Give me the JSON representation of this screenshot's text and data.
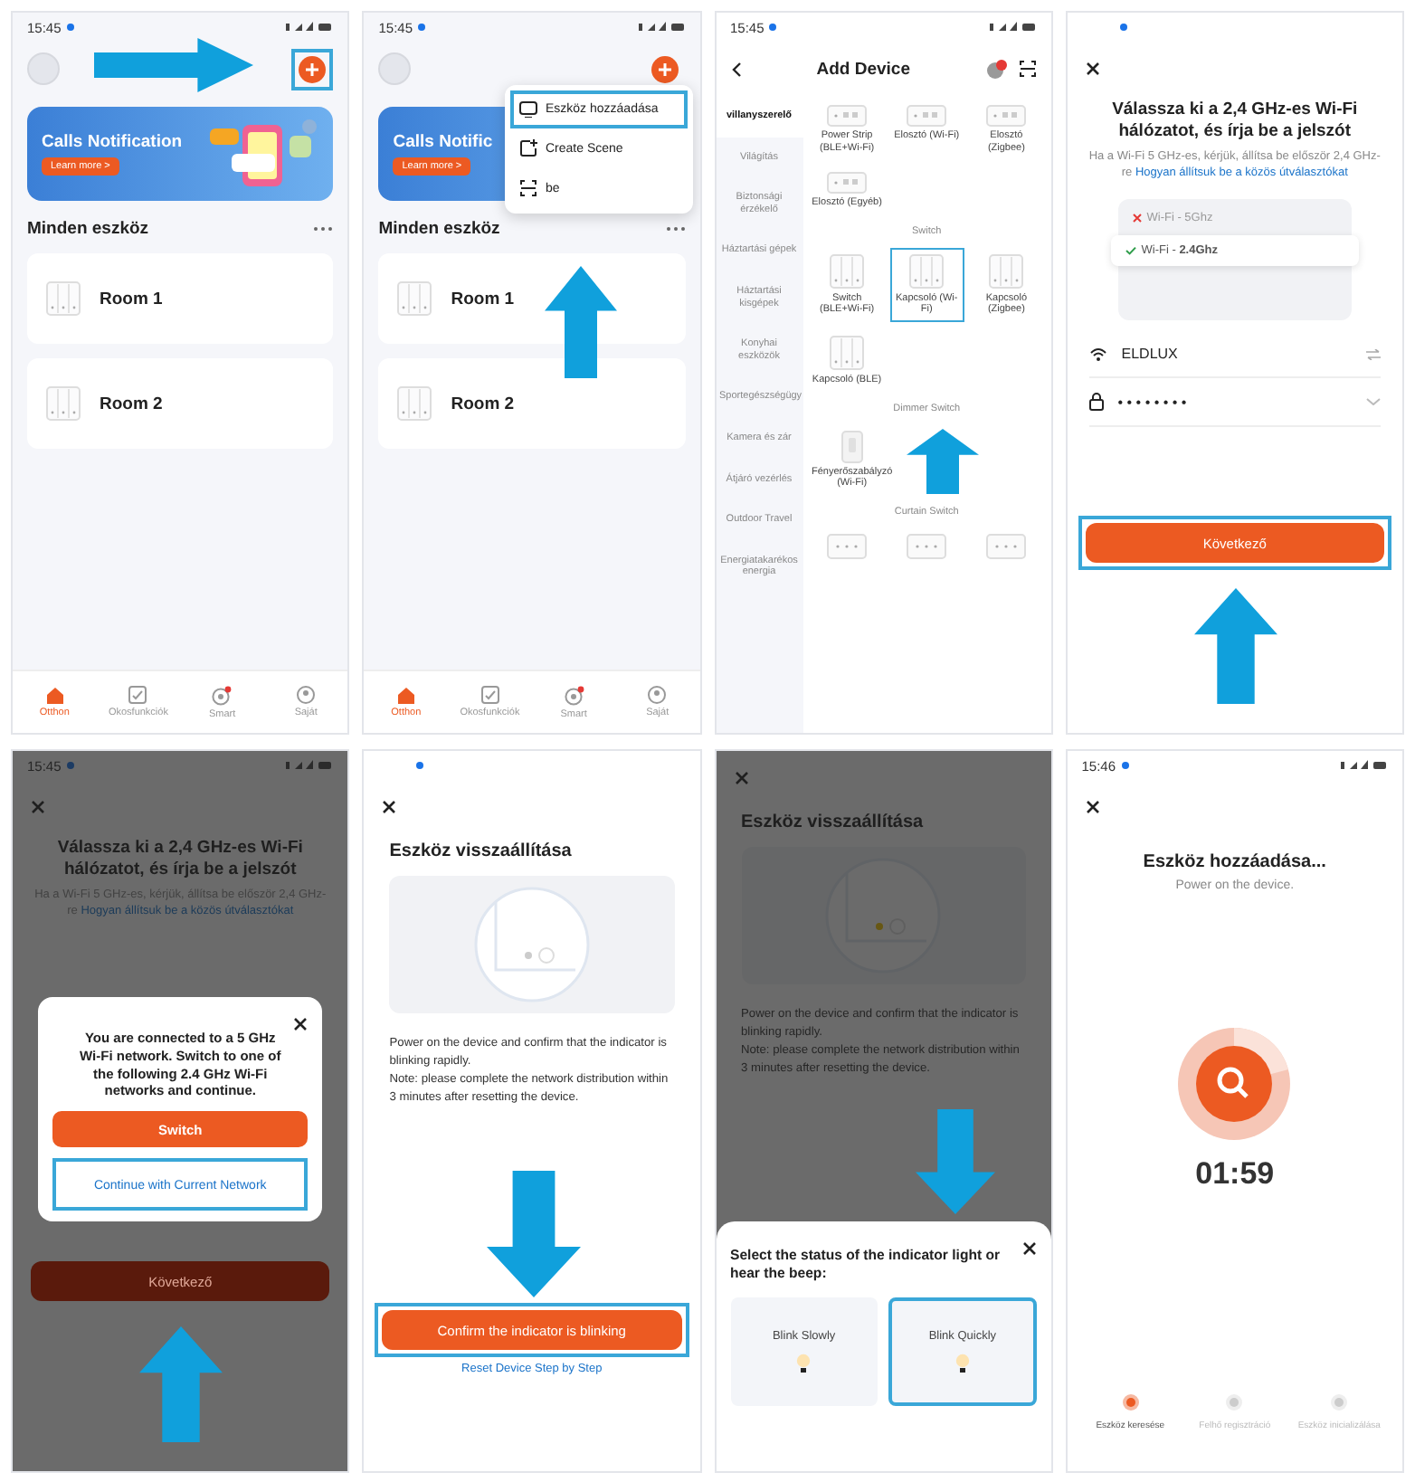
{
  "panels": [
    {
      "kind": "home",
      "status_time": "15:45",
      "status_dot": true,
      "add_highlighted": true,
      "arrow": {
        "kind": "right"
      },
      "banner": {
        "title": "Calls Notification",
        "button": "Learn more >"
      },
      "section_title": "Minden eszköz",
      "rooms": [
        "Room 1",
        "Room 2"
      ],
      "tabs": [
        {
          "label": "Otthon",
          "selected": true
        },
        {
          "label": "Okosfunkciók",
          "selected": false
        },
        {
          "label": "Smart",
          "selected": false
        },
        {
          "label": "Saját",
          "selected": false
        }
      ]
    },
    {
      "kind": "home",
      "status_time": "15:45",
      "status_dot": true,
      "add_highlighted": false,
      "arrow": {
        "kind": "up"
      },
      "banner": {
        "title": "Calls Notific",
        "button": "Learn more >"
      },
      "section_title": "Minden eszköz",
      "rooms": [
        "Room 1",
        "Room 2"
      ],
      "menu": [
        {
          "label": "Eszköz hozzáadása",
          "selected": true
        },
        {
          "label": "Create Scene",
          "selected": false
        },
        {
          "label": "be",
          "selected": false
        }
      ],
      "tabs": [
        {
          "label": "Otthon",
          "selected": true
        },
        {
          "label": "Okosfunkciók",
          "selected": false
        },
        {
          "label": "Smart",
          "selected": false
        },
        {
          "label": "Saját",
          "selected": false
        }
      ]
    },
    {
      "kind": "add_device",
      "status_time": "15:45",
      "status_dot": true,
      "title": "Add Device",
      "arrow": {
        "kind": "up"
      },
      "categories": [
        {
          "label": "villanyszerelő",
          "selected": true
        },
        {
          "label": "Világítás",
          "selected": false
        },
        {
          "label": "Biztonsági érzékelő",
          "selected": false
        },
        {
          "label": "Háztartási gépek",
          "selected": false
        },
        {
          "label": "Háztartási kisgépek",
          "selected": false
        },
        {
          "label": "Konyhai eszközök",
          "selected": false
        },
        {
          "label": "Sportegészségügy",
          "selected": false
        },
        {
          "label": "Kamera és zár",
          "selected": false
        },
        {
          "label": "Átjáró vezérlés",
          "selected": false
        },
        {
          "label": "Outdoor Travel",
          "selected": false
        },
        {
          "label": "Energiatakarékos energia",
          "selected": false
        }
      ],
      "sections": [
        {
          "items": [
            {
              "kind": "strip",
              "label": "Power Strip (BLE+Wi-Fi)",
              "selected": false
            },
            {
              "kind": "strip",
              "label": "Elosztó (Wi-Fi)",
              "selected": false
            },
            {
              "kind": "strip",
              "label": "Elosztó (Zigbee)",
              "selected": false
            },
            {
              "kind": "strip",
              "label": "Elosztó (Egyéb)",
              "selected": false
            }
          ]
        },
        {
          "title": "Switch",
          "items": [
            {
              "kind": "switch",
              "label": "Switch (BLE+Wi-Fi)",
              "selected": false
            },
            {
              "kind": "switch",
              "label": "Kapcsoló (Wi-Fi)",
              "selected": true
            },
            {
              "kind": "switch",
              "label": "Kapcsoló (Zigbee)",
              "selected": false
            },
            {
              "kind": "switch",
              "label": "Kapcsoló (BLE)",
              "selected": false
            }
          ]
        },
        {
          "title": "Dimmer Switch",
          "items": [
            {
              "kind": "dimmer",
              "label": "Fényerőszabályzó (Wi-Fi)",
              "selected": false
            }
          ]
        },
        {
          "title": "Curtain Switch",
          "items": [
            {
              "kind": "curtain",
              "selected": false
            },
            {
              "kind": "curtain",
              "selected": false
            },
            {
              "kind": "curtain",
              "selected": false
            }
          ]
        }
      ]
    },
    {
      "kind": "wifi",
      "status_dot": true,
      "dimmed": false,
      "arrow": {
        "kind": "up"
      },
      "title": "Válassza ki a 2,4 GHz-es Wi-Fi hálózatot, és írja be a jelszót",
      "hint": "Ha a Wi-Fi 5 GHz-es, kérjük, állítsa be először 2,4 GHz-re",
      "hint_link": "Hogyan állítsuk be a közös útválasztókat",
      "networks": [
        {
          "label": "Wi-Fi - 5Ghz",
          "ok": false
        },
        {
          "label": "Wi-Fi - **2.4Ghz**",
          "ok": true
        }
      ],
      "ssid": "ELDLUX",
      "password": "• • • • • • • •",
      "button": "Következő",
      "button_highlighted": true
    },
    {
      "kind": "wifi",
      "status_time": "15:45",
      "status_dot": true,
      "dimmed": true,
      "arrow": {
        "kind": "up"
      },
      "title": "Válassza ki a 2,4 GHz-es Wi-Fi hálózatot, és írja be a jelszót",
      "hint": "Ha a Wi-Fi 5 GHz-es, kérjük, állítsa be először 2,4 GHz-re",
      "hint_link": "Hogyan állítsuk be a közös útválasztókat",
      "button": "Következő",
      "button_highlighted": false,
      "dialog": {
        "text": "You are connected to a 5 GHz Wi-Fi network. Switch to one of the following 2.4 GHz Wi-Fi networks and continue.",
        "primary": "Switch",
        "secondary": "Continue with Current Network",
        "secondary_highlighted": true
      }
    },
    {
      "kind": "reset",
      "status_dot": true,
      "dimmed": false,
      "arrow": {
        "kind": "down"
      },
      "indicator_on": false,
      "title": "Eszköz visszaállítása",
      "text": [
        "Power on the device and confirm that the indicator is blinking rapidly.",
        "Note: please complete the network distribution within 3 minutes after resetting the device."
      ],
      "button": "Confirm the indicator is blinking",
      "button_highlighted": true,
      "link": "Reset Device Step by Step"
    },
    {
      "kind": "reset",
      "dimmed": true,
      "arrow": {
        "kind": "down"
      },
      "indicator_on": true,
      "title": "Eszköz visszaállítása",
      "text": [
        "Power on the device and confirm that the indicator is blinking rapidly.",
        "Note: please complete the network distribution within 3 minutes after resetting the device."
      ],
      "sheet": {
        "title": "Select the status of the indicator light or hear the beep:",
        "options": [
          {
            "label": "Blink Slowly",
            "selected": false
          },
          {
            "label": "Blink Quickly",
            "selected": true
          }
        ]
      }
    },
    {
      "kind": "adding",
      "status_time": "15:46",
      "status_dot": true,
      "title": "Eszköz hozzáadása...",
      "subtitle": "Power on the device.",
      "timer": "01:59",
      "steps": [
        {
          "label": "Eszköz keresése",
          "active": true
        },
        {
          "label": "Felhő regisztráció",
          "active": false
        },
        {
          "label": "Eszköz inicializálása",
          "active": false
        }
      ]
    }
  ]
}
